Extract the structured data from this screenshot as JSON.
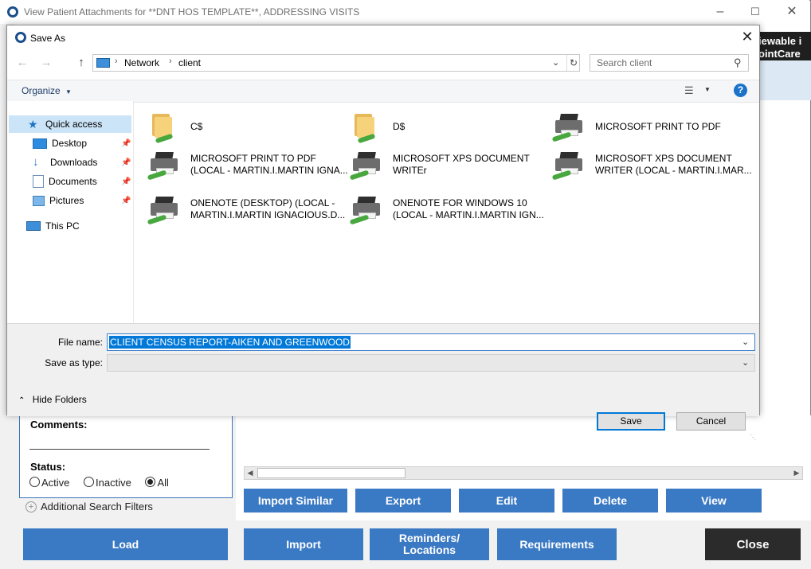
{
  "background_window": {
    "title": "View Patient Attachments for **DNT HOS TEMPLATE**, ADDRESSING VISITS",
    "right_banner_line1": "iewable i",
    "right_banner_line2": "ointCare",
    "filter_panel": {
      "comments_label": "Comments:",
      "status_label": "Status:",
      "status_options": [
        "Active",
        "Inactive",
        "All"
      ],
      "status_selected": "All",
      "additional_filters": "Additional Search Filters"
    },
    "action_buttons": [
      "Import Similar",
      "Export",
      "Edit",
      "Delete",
      "View"
    ],
    "bottom_buttons": {
      "load": "Load",
      "import": "Import",
      "reminders_line1": "Reminders/",
      "reminders_line2": "Locations",
      "requirements": "Requirements",
      "close": "Close"
    },
    "colors": {
      "button_blue": "#3a79c4",
      "close_dark": "#2b2b2b"
    }
  },
  "dialog": {
    "title": "Save As",
    "address_parts": [
      "Network",
      "client"
    ],
    "search_placeholder": "Search client",
    "organize_label": "Organize",
    "nav_items": [
      {
        "label": "Quick access",
        "icon": "star-icon",
        "pinned": false,
        "selected": true
      },
      {
        "label": "Desktop",
        "icon": "desktop-icon",
        "pinned": true
      },
      {
        "label": "Downloads",
        "icon": "download-icon",
        "pinned": true
      },
      {
        "label": "Documents",
        "icon": "documents-icon",
        "pinned": true
      },
      {
        "label": "Pictures",
        "icon": "pictures-icon",
        "pinned": true
      },
      {
        "label": "This PC",
        "icon": "computer-icon",
        "pinned": false
      }
    ],
    "files": [
      {
        "line1": "C$",
        "line2": "",
        "icon": "network-folder-icon"
      },
      {
        "line1": "D$",
        "line2": "",
        "icon": "network-folder-icon"
      },
      {
        "line1": "MICROSOFT PRINT TO PDF",
        "line2": "",
        "icon": "network-printer-icon"
      },
      {
        "line1": "MICROSOFT PRINT TO PDF",
        "line2": "(LOCAL - MARTIN.I.MARTIN IGNA...",
        "icon": "network-printer-icon"
      },
      {
        "line1": "MICROSOFT XPS DOCUMENT",
        "line2": "WRITEr",
        "icon": "network-printer-icon"
      },
      {
        "line1": "MICROSOFT XPS DOCUMENT",
        "line2": "WRITER (LOCAL - MARTIN.I.MAR...",
        "icon": "network-printer-icon"
      },
      {
        "line1": "ONENOTE (DESKTOP) (LOCAL -",
        "line2": "MARTIN.I.MARTIN IGNACIOUS.D...",
        "icon": "network-printer-icon"
      },
      {
        "line1": "ONENOTE FOR WINDOWS 10",
        "line2": "(LOCAL - MARTIN.I.MARTIN IGN...",
        "icon": "network-printer-icon"
      }
    ],
    "file_name_label": "File name:",
    "file_name_value": "CLIENT CENSUS REPORT-AIKEN AND GREENWOOD",
    "save_as_type_label": "Save as type:",
    "save_as_type_value": "",
    "hide_folders_label": "Hide Folders",
    "save_label": "Save",
    "cancel_label": "Cancel",
    "colors": {
      "selection": "#0078d7",
      "help": "#1a73c8"
    }
  }
}
